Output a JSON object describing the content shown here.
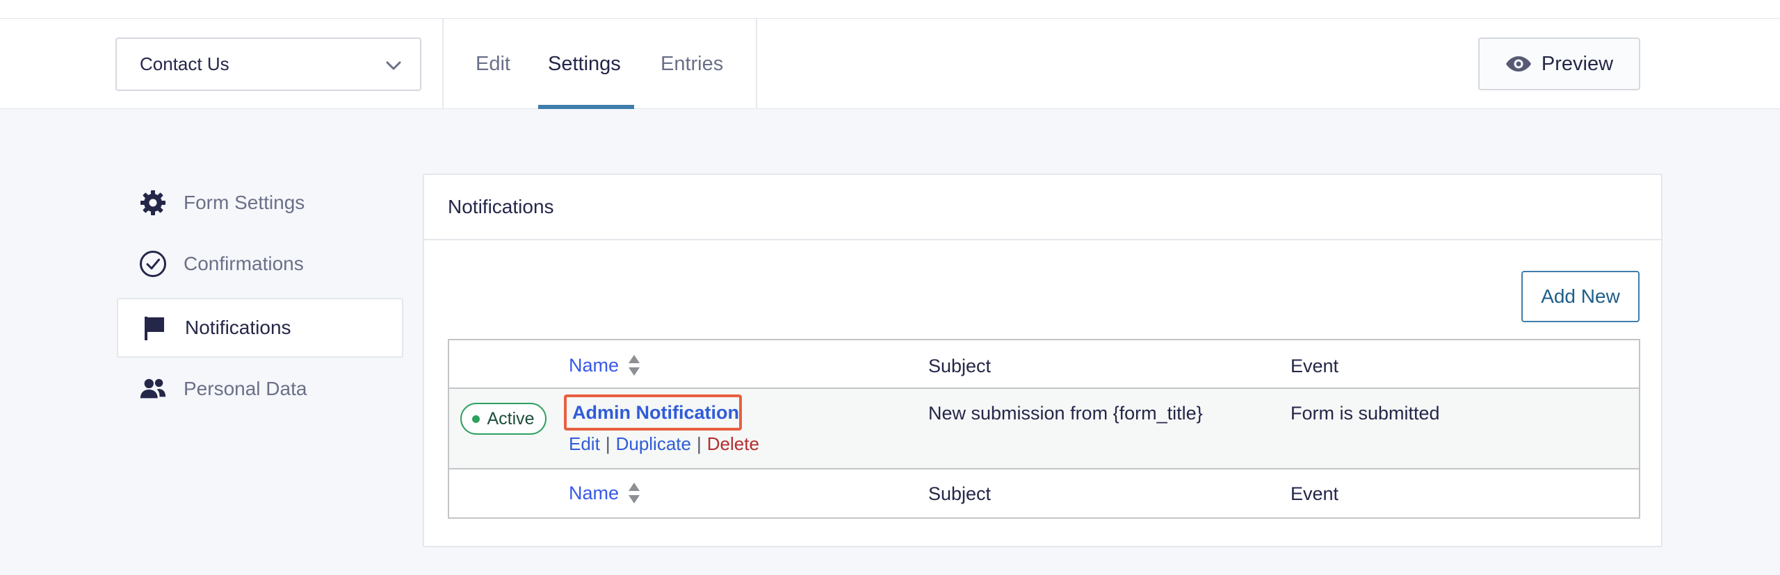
{
  "header": {
    "form_selector": {
      "value": "Contact Us"
    },
    "tabs": [
      {
        "label": "Edit",
        "active": false
      },
      {
        "label": "Settings",
        "active": true
      },
      {
        "label": "Entries",
        "active": false
      }
    ],
    "preview_label": "Preview"
  },
  "sidebar": {
    "items": [
      {
        "label": "Form Settings",
        "icon": "gear-icon",
        "active": false
      },
      {
        "label": "Confirmations",
        "icon": "check-circle-icon",
        "active": false
      },
      {
        "label": "Notifications",
        "icon": "flag-icon",
        "active": true
      },
      {
        "label": "Personal Data",
        "icon": "users-icon",
        "active": false
      }
    ]
  },
  "panel": {
    "title": "Notifications",
    "add_new_label": "Add New",
    "table": {
      "columns": {
        "name": "Name",
        "subject": "Subject",
        "event": "Event"
      },
      "rows": [
        {
          "status": "Active",
          "name": "Admin Notification",
          "subject": "New submission from {form_title}",
          "event": "Form is submitted",
          "actions": {
            "edit": "Edit",
            "duplicate": "Duplicate",
            "delete": "Delete",
            "separator": "|"
          }
        }
      ]
    }
  },
  "colors": {
    "accent": "#3e7dab",
    "link": "#3858e9",
    "active_green": "#2ea160",
    "delete_red": "#b32d2e",
    "highlight": "#e8603f"
  }
}
